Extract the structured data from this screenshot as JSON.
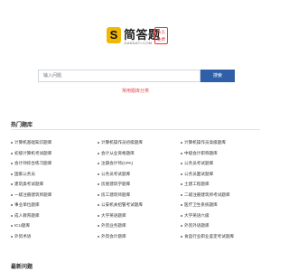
{
  "brand": {
    "logo_mark": "S",
    "name": "简答题",
    "subname": "JIANDATI.COM",
    "badge": "永久免费"
  },
  "search": {
    "placeholder": "输入问题",
    "button_label": "搜索",
    "hint": "常用题库分类"
  },
  "sections": {
    "hot_title": "热门题库",
    "latest_title": "最新问题"
  },
  "hot_items": [
    "计算机基础知识题库",
    "计算机操作员初级题库",
    "计算机操作员高级题库",
    "初级计算机考试题库",
    "会计从业资格题库",
    "中级会计职称题库",
    "会计师综合练习题库",
    "注册会计师(CPA)",
    "公务员考试题库",
    "国家公务员",
    "公务员考试题库",
    "公务员面试题库",
    "建筑类考试题库",
    "房屋建筑学题库",
    "土建工程题库",
    "一级注册建筑师题库",
    "房工建筑师题库",
    "二级注册建筑师考试题库",
    "事业单位题库",
    "公安机关招警考试题库",
    "医疗卫生系统题库",
    "成人教育题库",
    "大学英语题库",
    "大学英语六级",
    "ICU题库",
    "外贸业务题库",
    "外贸外语题库",
    "外贸术语",
    "外贸会计题库",
    "食品行业职业鉴定考试题库"
  ]
}
